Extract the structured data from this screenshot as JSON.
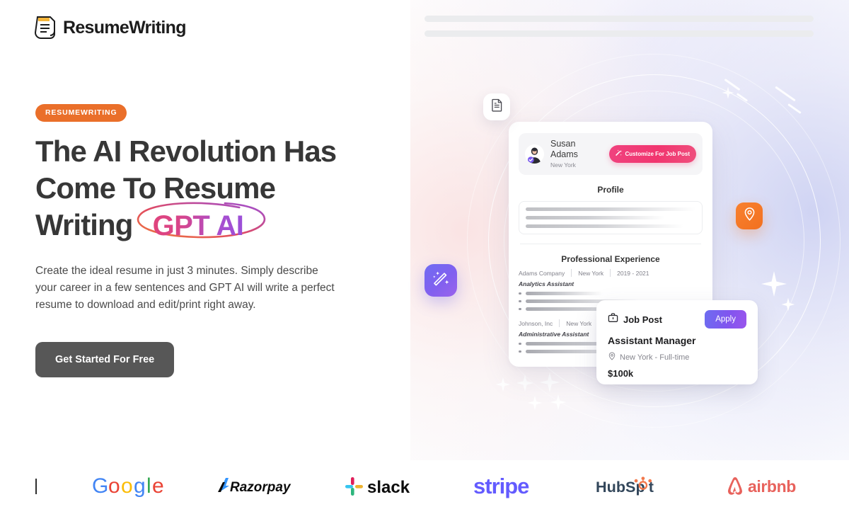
{
  "brand": {
    "name": "ResumeWriting",
    "logo_icon": "document-lines-icon"
  },
  "top_skeleton": {
    "bar_count": 2,
    "color": "#ebecee"
  },
  "hero": {
    "badge": "RESUMEWRITING",
    "badge_color": "#ea6f2a",
    "headline_line1": "The AI Revolution Has",
    "headline_line2": "Come To Resume",
    "headline_line3": "Writing",
    "headline_highlight": "GPT AI",
    "highlight_gradient_from": "#e0447c",
    "highlight_gradient_to": "#9b4fd8",
    "circle_gradient_from": "#ef7a3c",
    "circle_gradient_to": "#9b4fd8",
    "subtext": "Create the ideal resume in just 3 minutes. Simply describe your career in a few sentences and GPT AI will write a perfect resume to download and edit/print right away.",
    "cta_label": "Get Started For Free",
    "cta_color": "#575757"
  },
  "resume_card": {
    "person_name": "Susan Adams",
    "person_location": "New York",
    "avatar_icon": "user-avatar",
    "verified_icon": "verified-check-icon",
    "customize_button": {
      "label": "Customize For Job Post",
      "icon": "magic-wand-icon",
      "gradient_from": "#f0437f",
      "gradient_to": "#ef4f7d"
    },
    "profile_heading": "Profile",
    "profile_skeleton_lines": [
      100,
      82,
      93
    ],
    "experience_heading": "Professional Experience",
    "experience": [
      {
        "company": "Adams Company",
        "location": "New York",
        "dates": "2019 - 2021",
        "role": "Analytics Assistant",
        "bullet_widths": [
          42,
          62,
          72
        ]
      },
      {
        "company": "Johnson, Inc",
        "location": "New York",
        "dates": "",
        "role": "Administrative Assistant",
        "bullet_widths": [
          88,
          66
        ]
      }
    ]
  },
  "job_post": {
    "card_title": "Job Post",
    "briefcase_icon": "briefcase-icon",
    "role": "Assistant Manager",
    "location_icon": "location-pin-icon",
    "location_line": "New York - Full-time",
    "salary": "$100k",
    "apply_label": "Apply",
    "apply_gradient_from": "#6d6df0",
    "apply_gradient_to": "#9a55ec"
  },
  "floating_tiles": [
    {
      "name": "document-tile",
      "icon": "document-icon",
      "color": "#ffffff"
    },
    {
      "name": "magic-wand-tile",
      "icon": "magic-wand-icon",
      "color": "#7a66f0"
    },
    {
      "name": "location-tile",
      "icon": "location-pin-icon",
      "color": "#f4781f"
    }
  ],
  "logo_strip": {
    "brands": [
      {
        "name": "Google",
        "color": "#4285f4"
      },
      {
        "name": "Razorpay",
        "color": "#0c0c0c"
      },
      {
        "name": "slack",
        "color": "#0b0b0b"
      },
      {
        "name": "stripe",
        "color": "#635bff"
      },
      {
        "name": "HubSpot",
        "color": "#33475b"
      },
      {
        "name": "airbnb",
        "color": "#e8625c"
      }
    ]
  }
}
